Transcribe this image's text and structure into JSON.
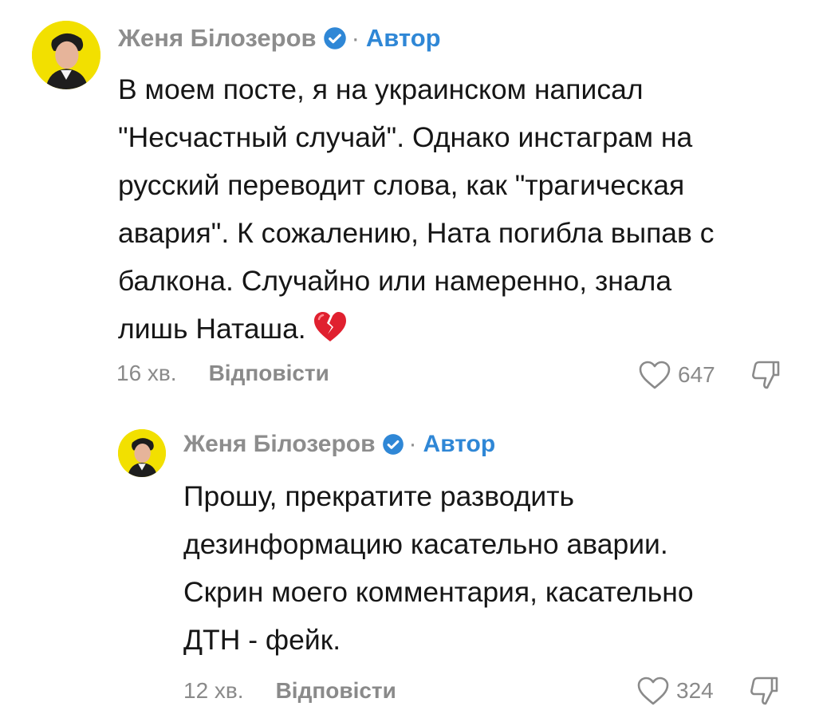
{
  "comments": [
    {
      "author": "Женя Білозеров",
      "separator": "·",
      "role": "Автор",
      "lines": [
        "В моем посте, я на украинском написал",
        "\"Несчастный случай\". Однако инстаграм на",
        "русский переводит слова, как \"трагическая",
        "авария\". К сожалению, Ната погибла выпав с",
        "балкона. Случайно или намеренно, знала",
        "лишь Наташа."
      ],
      "emoji": "broken-heart",
      "time": "16 хв.",
      "reply_label": "Відповісти",
      "likes": "647"
    },
    {
      "author": "Женя Білозеров",
      "separator": "·",
      "role": "Автор",
      "lines": [
        "Прошу, прекратите разводить",
        "дезинформацию касательно аварии.",
        "Скрин моего комментария, касательно",
        "ДТН - фейк."
      ],
      "time": "12 хв.",
      "reply_label": "Відповісти",
      "likes": "324"
    }
  ],
  "colors": {
    "muted": "#8a8a8a",
    "author_name": "#8d8d8d",
    "role_accent": "#2f87d6",
    "avatar_bg": "#f2e000",
    "broken_heart": "#e0202f"
  },
  "icons": {
    "verified": "verified-badge-icon",
    "like": "heart-outline-icon",
    "dislike": "thumbs-down-outline-icon",
    "emoji": "broken-heart-emoji"
  }
}
